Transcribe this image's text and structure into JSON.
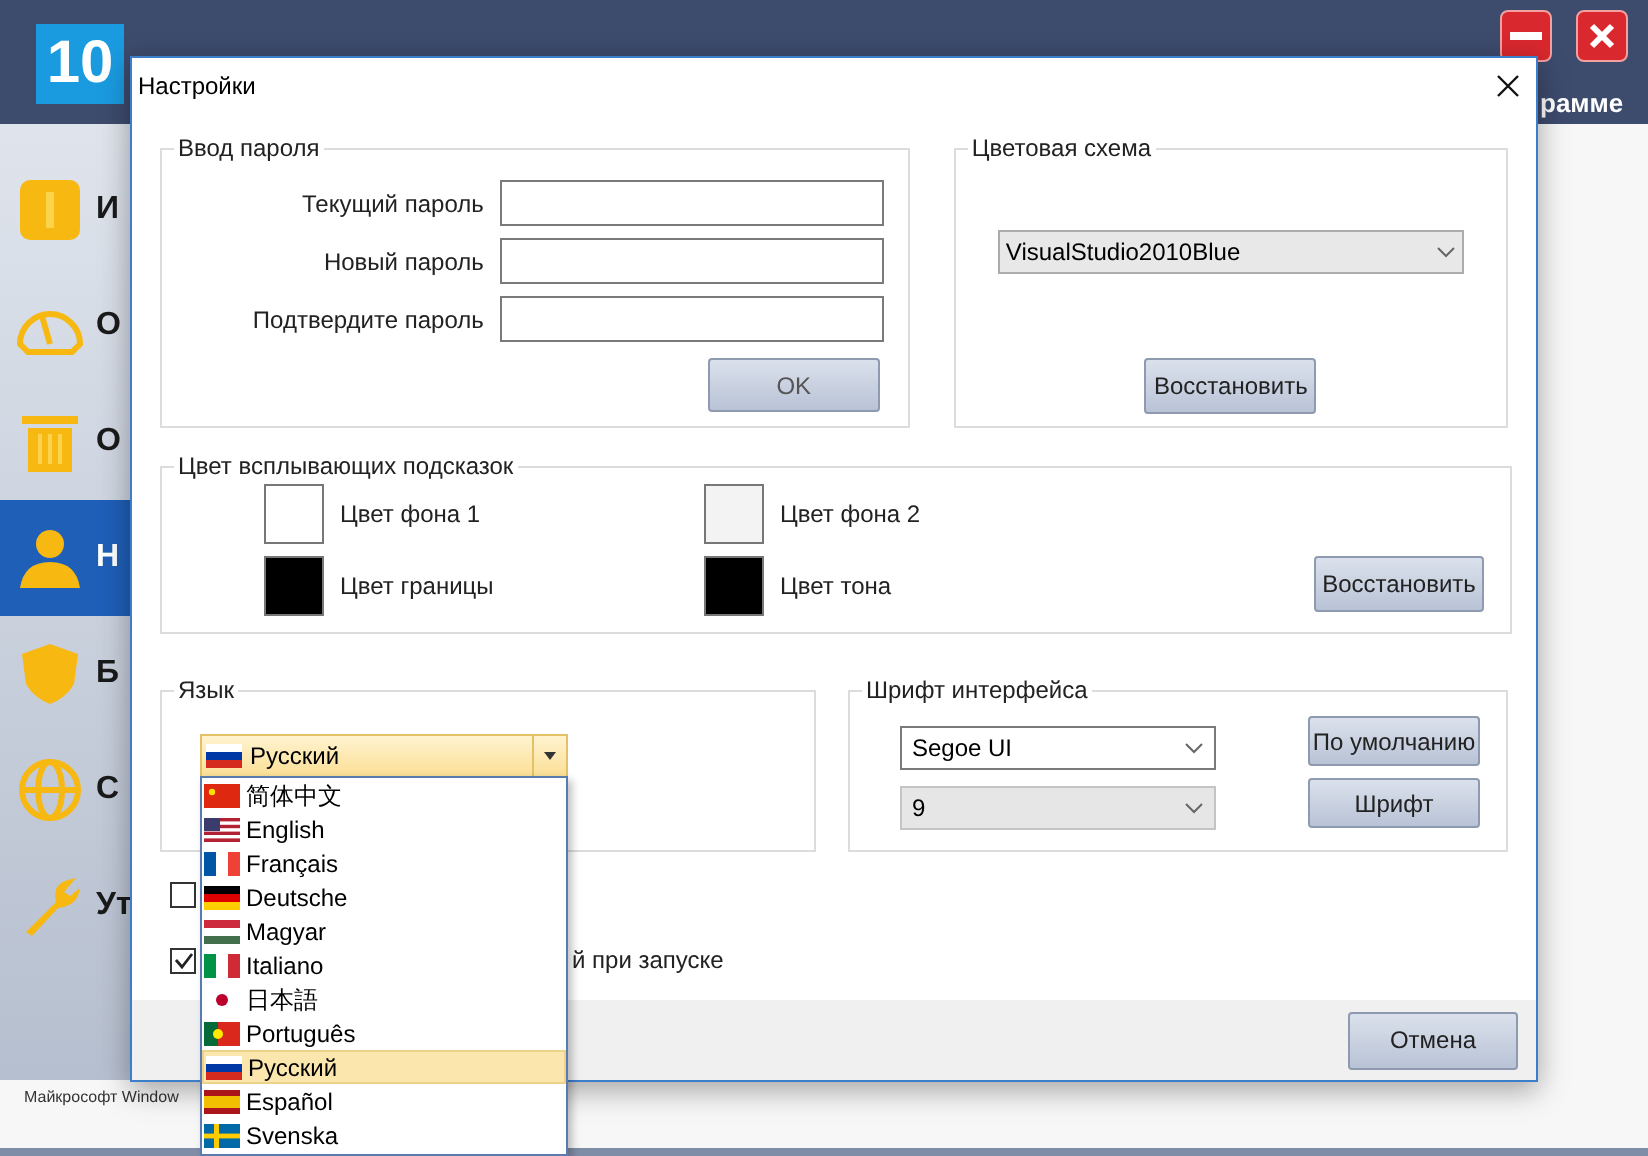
{
  "app": {
    "logo": "10",
    "menu_fragment": "рамме",
    "footer": "Майкрософт Window"
  },
  "sidebar": {
    "items": [
      {
        "label": "И",
        "kind": "info",
        "selected": false
      },
      {
        "label": "О",
        "kind": "gauge",
        "selected": false
      },
      {
        "label": "О",
        "kind": "trash",
        "selected": false
      },
      {
        "label": "Н",
        "kind": "user",
        "selected": true
      },
      {
        "label": "Б",
        "kind": "shield",
        "selected": false
      },
      {
        "label": "С",
        "kind": "globe",
        "selected": false
      },
      {
        "label": "Ут",
        "kind": "wrench",
        "selected": false
      }
    ]
  },
  "dialog": {
    "title": "Настройки",
    "password": {
      "title": "Ввод пароля",
      "fields": [
        {
          "label": "Текущий пароль"
        },
        {
          "label": "Новый пароль"
        },
        {
          "label": "Подтвердите пароль"
        }
      ],
      "button": "OK"
    },
    "scheme": {
      "title": "Цветовая схема",
      "value": "VisualStudio2010Blue",
      "button": "Восстановить"
    },
    "tooltip_colors": {
      "title": "Цвет всплывающих подсказок",
      "swatches": [
        {
          "label": "Цвет фона 1",
          "color": "#ffffff"
        },
        {
          "label": "Цвет фона 2",
          "color": "#f3f3f3"
        },
        {
          "label": "Цвет границы",
          "color": "#000000"
        },
        {
          "label": "Цвет тона",
          "color": "#000000"
        }
      ],
      "button": "Восстановить"
    },
    "language": {
      "title": "Язык",
      "value": "Русский",
      "kind": "ru",
      "options": [
        {
          "label": "简体中文",
          "kind": "cn",
          "selected": false
        },
        {
          "label": "English",
          "kind": "us",
          "selected": false
        },
        {
          "label": "Français",
          "kind": "fr",
          "selected": false
        },
        {
          "label": "Deutsche",
          "kind": "de",
          "selected": false
        },
        {
          "label": "Magyar",
          "kind": "hu",
          "selected": false
        },
        {
          "label": "Italiano",
          "kind": "it",
          "selected": false
        },
        {
          "label": "日本語",
          "kind": "jp",
          "selected": false
        },
        {
          "label": "Português",
          "kind": "pt",
          "selected": false
        },
        {
          "label": "Русский",
          "kind": "ru",
          "selected": true
        },
        {
          "label": "Español",
          "kind": "es",
          "selected": false
        },
        {
          "label": "Svenska",
          "kind": "se",
          "selected": false
        }
      ]
    },
    "font": {
      "title": "Шрифт интерфейса",
      "family": "Segoe UI",
      "size": "9",
      "size_disabled": true,
      "default_button": "По умолчанию",
      "font_button": "Шрифт"
    },
    "checkboxes": [
      {
        "checked": false
      },
      {
        "label": "й при запуске",
        "checked": true
      }
    ],
    "cancel": "Отмена"
  }
}
